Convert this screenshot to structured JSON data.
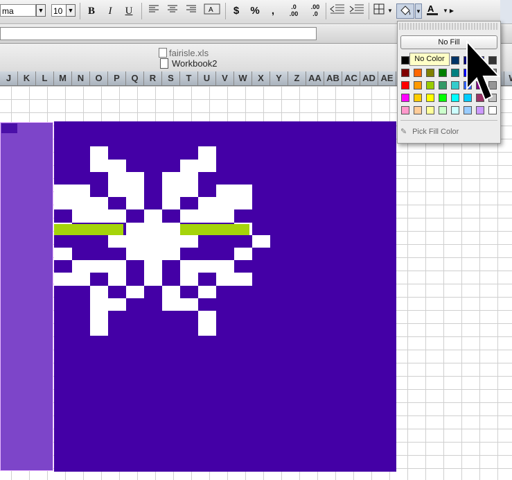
{
  "toolbar": {
    "font_name": "ma",
    "font_size": "10",
    "bold_label": "B",
    "italic_label": "I",
    "underline_label": "U",
    "currency_label": "$",
    "percent_label": "%",
    "comma_label": ",",
    "inc_decimal_label": ".0\n.00",
    "dec_decimal_label": ".00\n.0"
  },
  "tabs": {
    "inactive_file": "fairisle.xls",
    "active_file": "Workbook2"
  },
  "columns": [
    "J",
    "K",
    "L",
    "M",
    "N",
    "O",
    "P",
    "Q",
    "R",
    "S",
    "T",
    "U",
    "V",
    "W",
    "X",
    "Y",
    "Z",
    "AA",
    "AB",
    "AC",
    "AD",
    "AE",
    "",
    "",
    "",
    "",
    "",
    "",
    "W"
  ],
  "fill_palette": {
    "no_fill_label": "No Fill",
    "tooltip": "No Color",
    "pick_label": "Pick Fill Color",
    "swatch_rows": [
      [
        "#000000",
        "#993300",
        "#333300",
        "#003300",
        "#003366",
        "#000080",
        "#333399",
        "#333333"
      ],
      [
        "#800000",
        "#ff6600",
        "#808000",
        "#008000",
        "#008080",
        "#0000ff",
        "#666699",
        "#808080"
      ],
      [
        "#ff0000",
        "#ff9900",
        "#99cc00",
        "#339966",
        "#33cccc",
        "#3366ff",
        "#800080",
        "#969696"
      ],
      [
        "#ff00ff",
        "#ffcc00",
        "#ffff00",
        "#00ff00",
        "#00ffff",
        "#00ccff",
        "#993366",
        "#c0c0c0"
      ],
      [
        "#ff99cc",
        "#ffcc99",
        "#ffff99",
        "#ccffcc",
        "#ccffff",
        "#99ccff",
        "#cc99ff",
        "#ffffff"
      ]
    ]
  },
  "colors": {
    "sheet_fill": "#4400a6",
    "selection_fill": "#7d45c9",
    "snowflake": "#ffffff",
    "accent_green": "#a5d40a"
  }
}
